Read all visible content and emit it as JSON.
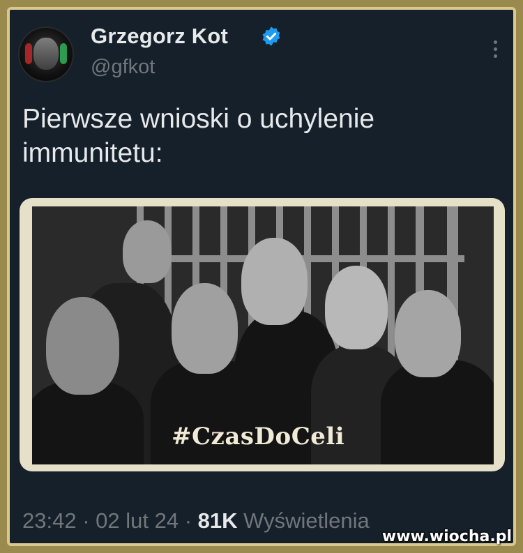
{
  "tweet": {
    "author_name": "Grzegorz Kot",
    "author_handle": "@gfkot",
    "text": "Pierwsze wnioski o uchylenie immunitetu:",
    "time": "23:42",
    "separator": "·",
    "date": "02 lut 24",
    "views_count": "81K",
    "views_label": "Wyświetlenia"
  },
  "media": {
    "hashtag": "#CzasDoCeli"
  },
  "watermark": "www.wiocha.pl",
  "colors": {
    "background": "#15202b",
    "verified": "#1d9bf0",
    "primary_text": "#e7e9ea",
    "secondary_text": "#71767b",
    "frame": "#d9c98e"
  }
}
